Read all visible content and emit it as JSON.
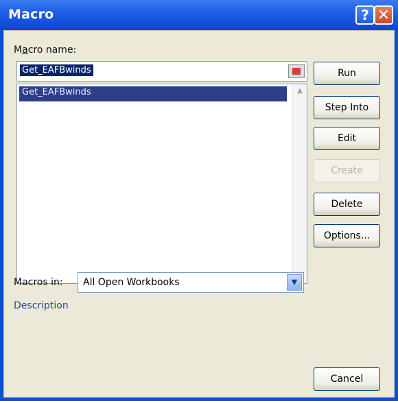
{
  "window": {
    "title": "Macro",
    "help_label": "?",
    "close_label": "✕"
  },
  "macro_name": {
    "label_prefix": "M",
    "label_underlined": "a",
    "label_suffix": "cro name:",
    "value": "Get_EAFBwinds"
  },
  "macro_list": {
    "items": [
      "Get_EAFBwinds"
    ]
  },
  "buttons": {
    "run": "Run",
    "step_into": "Step Into",
    "edit": "Edit",
    "create": "Create",
    "delete": "Delete",
    "options": "Options...",
    "cancel": "Cancel"
  },
  "macros_in": {
    "label": "Macros in:",
    "value": "All Open Workbooks"
  },
  "description_label": "Description",
  "icons": {
    "scroll_up": "▲",
    "scroll_down": "▼",
    "dropdown": "▼"
  }
}
